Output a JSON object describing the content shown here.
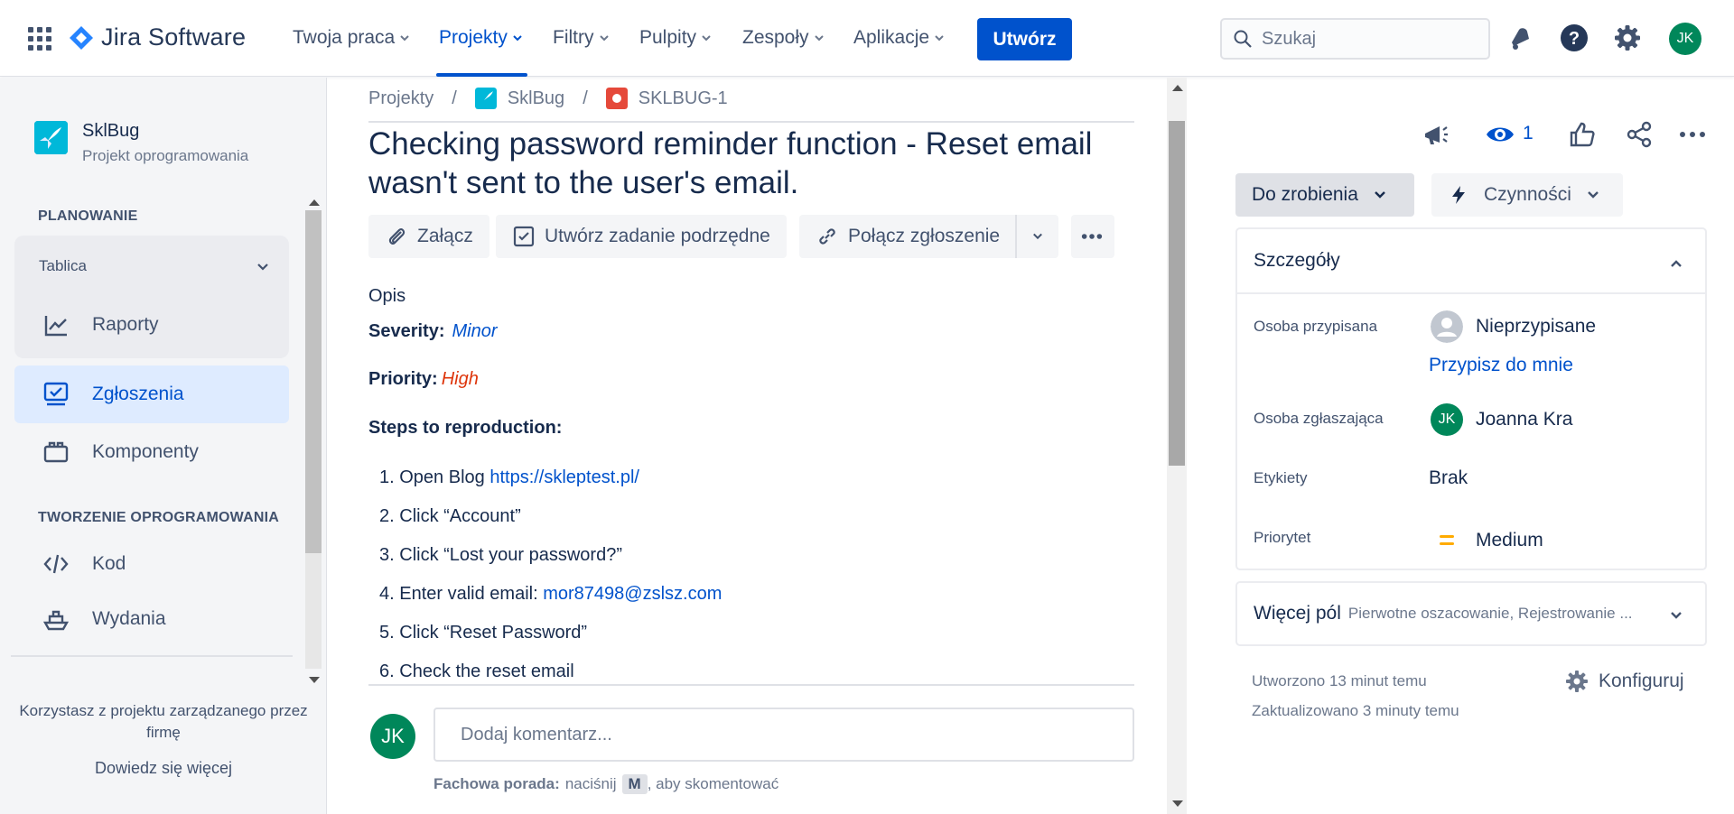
{
  "topnav": {
    "app_name": "Jira Software",
    "items": [
      {
        "label": "Twoja praca"
      },
      {
        "label": "Projekty"
      },
      {
        "label": "Filtry"
      },
      {
        "label": "Pulpity"
      },
      {
        "label": "Zespoły"
      },
      {
        "label": "Aplikacje"
      }
    ],
    "active_item": "Projekty",
    "create_label": "Utwórz",
    "search_placeholder": "Szukaj",
    "avatar_initials": "JK"
  },
  "sidebar": {
    "project_name": "SklBug",
    "project_type": "Projekt oprogramowania",
    "section_planning": "PLANOWANIE",
    "board_label": "Tablica",
    "items": [
      {
        "label": "Raporty",
        "icon": "chart-icon"
      },
      {
        "label": "Zgłoszenia",
        "icon": "issues-icon"
      },
      {
        "label": "Komponenty",
        "icon": "components-icon"
      },
      {
        "label": "Kod",
        "icon": "code-icon"
      },
      {
        "label": "Wydania",
        "icon": "ship-icon"
      }
    ],
    "section_dev": "TWORZENIE OPROGRAMOWANIA",
    "footer_text": "Korzystasz z projektu zarządzanego przez firmę",
    "footer_link": "Dowiedz się więcej"
  },
  "breadcrumb": {
    "root": "Projekty",
    "project": "SklBug",
    "issue_key": "SKLBUG-1",
    "separator": "/"
  },
  "issue": {
    "title": "Checking password reminder function - Reset email wasn't sent to the user's email.",
    "actions": [
      {
        "label": "Załącz"
      },
      {
        "label": "Utwórz zadanie podrzędne"
      },
      {
        "label": "Połącz zgłoszenie"
      }
    ],
    "description_label": "Opis",
    "severity_label": "Severity:",
    "severity_value": "Minor",
    "priority_label": "Priority:",
    "priority_value": "High",
    "steps_label": "Steps to reproduction:",
    "steps": [
      {
        "num": "1.",
        "text": "Open Blog ",
        "link": "https://skleptest.pl/"
      },
      {
        "num": "2.",
        "text": "Click “Account”",
        "link": ""
      },
      {
        "num": "3.",
        "text": "Click “Lost your password?”",
        "link": ""
      },
      {
        "num": "4.",
        "text": "Enter valid email: ",
        "link": "mor87498@zslsz.com"
      },
      {
        "num": "5.",
        "text": "Click “Reset Password”",
        "link": ""
      },
      {
        "num": "6.",
        "text": "Check the reset email",
        "link": ""
      }
    ]
  },
  "comment": {
    "avatar_initials": "JK",
    "placeholder": "Dodaj komentarz...",
    "tip_bold": "Fachowa porada:",
    "tip_pre": "naciśnij",
    "tip_key": "M",
    "tip_post": ", aby skomentować"
  },
  "panel": {
    "watch_count": "1",
    "status_label": "Do zrobienia",
    "actions_label": "Czynności",
    "details_title": "Szczegóły",
    "fields": {
      "assignee_label": "Osoba przypisana",
      "assignee_value": "Nieprzypisane",
      "assign_me": "Przypisz do mnie",
      "reporter_label": "Osoba zgłaszająca",
      "reporter_initials": "JK",
      "reporter_value": "Joanna Kra",
      "labels_label": "Etykiety",
      "labels_value": "Brak",
      "priority_label": "Priorytet",
      "priority_value": "Medium"
    },
    "more_title": "Więcej pól",
    "more_sub": "Pierwotne oszacowanie, Rejestrowanie ...",
    "created": "Utworzono 13 minut temu",
    "updated": "Zaktualizowano 3 minuty temu",
    "configure": "Konfiguruj"
  },
  "colors": {
    "brand": "#0052cc",
    "avatar": "#00875a",
    "high_priority": "#de350b",
    "medium_priority": "#ffab00"
  }
}
